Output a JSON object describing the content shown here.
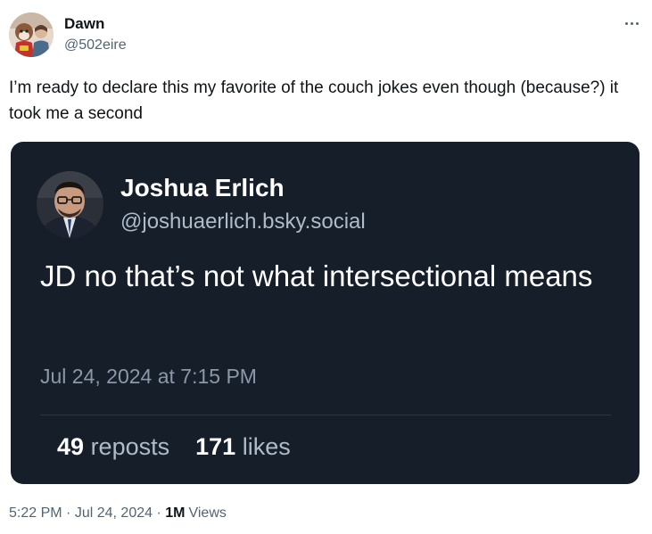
{
  "tweet": {
    "author_name": "Dawn",
    "author_handle": "@502eire",
    "text": "I’m ready to declare this my favorite of the couch jokes even though (because?) it took me a second",
    "time": "5:22 PM",
    "separator": "·",
    "date": "Jul 24, 2024",
    "views_count": "1M",
    "views_label": "Views",
    "more_icon": "more-horizontal-icon"
  },
  "embed": {
    "author_name": "Joshua Erlich",
    "author_handle": "@joshuaerlich.bsky.social",
    "text": "JD no that’s not what intersectional means",
    "date": "Jul 24, 2024 at 7:15 PM",
    "reposts_count": "49",
    "reposts_label": "reposts",
    "likes_count": "171",
    "likes_label": "likes",
    "background_color": "#161e29"
  }
}
